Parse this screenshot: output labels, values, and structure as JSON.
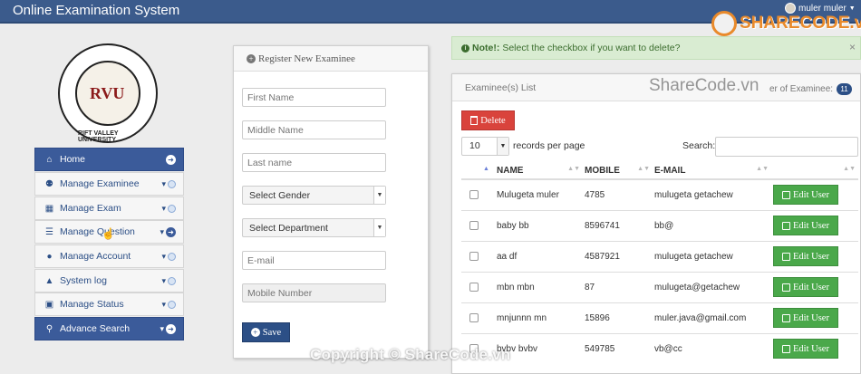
{
  "app": {
    "title": "Online Examination System",
    "user": "muler muler"
  },
  "watermarks": {
    "logo_text": "SHARECODE.vn",
    "center_text": "ShareCode.vn",
    "copyright": "Copyright © ShareCode.vn"
  },
  "logo": {
    "mark": "RVU",
    "ring_text": "RIFT VALLEY UNIVERSITY"
  },
  "sidebar": {
    "items": [
      {
        "label": "Home",
        "icon": "home-icon",
        "active": true
      },
      {
        "label": "Manage Examinee",
        "icon": "users-icon"
      },
      {
        "label": "Manage Exam",
        "icon": "grid-icon"
      },
      {
        "label": "Manage Question",
        "icon": "list-icon"
      },
      {
        "label": "Manage Account",
        "icon": "user-icon"
      },
      {
        "label": "System log",
        "icon": "warning-icon"
      },
      {
        "label": "Manage Status",
        "icon": "edit-icon"
      },
      {
        "label": "Advance Search",
        "icon": "search-icon",
        "active": true
      }
    ]
  },
  "register": {
    "title": "Register New Examinee",
    "first_name_placeholder": "First Name",
    "middle_name_placeholder": "Middle Name",
    "last_name_placeholder": "Last name",
    "gender_select": "Select Gender",
    "department_select": "Select Department",
    "email_placeholder": "E-mail",
    "mobile_placeholder": "Mobile Number",
    "save_label": "Save"
  },
  "alert": {
    "bold": "Note!:",
    "text": "Select the checkbox if you want to delete?",
    "close": "×"
  },
  "examinee_list": {
    "title": "Examinee(s) List",
    "count_label": "er of Examinee:",
    "count": "11",
    "delete_label": "Delete",
    "records_per_page": "10",
    "records_label": "records per page",
    "search_label": "Search:",
    "columns": [
      "NAME",
      "MOBILE",
      "E-MAIL"
    ],
    "edit_label": "Edit User",
    "rows": [
      {
        "name": "Mulugeta muler",
        "mobile": "4785",
        "email": "mulugeta getachew"
      },
      {
        "name": "baby bb",
        "mobile": "8596741",
        "email": "bb@"
      },
      {
        "name": "aa df",
        "mobile": "4587921",
        "email": "mulugeta getachew"
      },
      {
        "name": "mbn mbn",
        "mobile": "87",
        "email": "mulugeta@getachew"
      },
      {
        "name": "mnjunnn mn",
        "mobile": "15896",
        "email": "muler.java@gmail.com"
      },
      {
        "name": "bvbv bvbv",
        "mobile": "549785",
        "email": "vb@cc"
      }
    ]
  },
  "colors": {
    "navbar": "#3b5b8c",
    "primary": "#2c4f86",
    "danger": "#d9433c",
    "success": "#4aa84a",
    "alert_bg": "#d9ecd2"
  }
}
